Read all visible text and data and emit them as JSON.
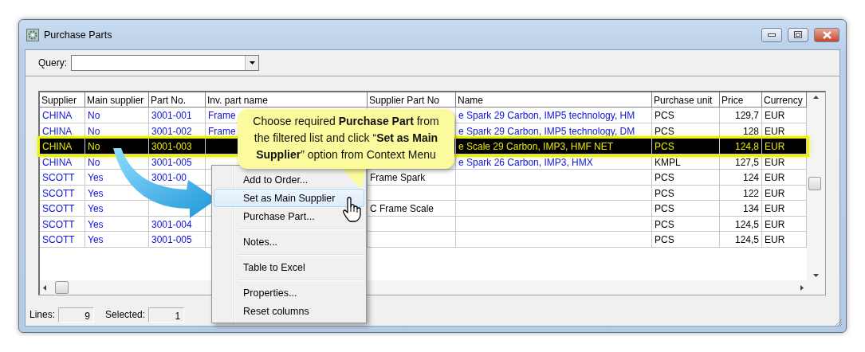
{
  "window": {
    "title": "Purchase Parts"
  },
  "query": {
    "label": "Query:"
  },
  "table": {
    "columns": [
      {
        "label": "Supplier",
        "kind": "link"
      },
      {
        "label": "Main supplier",
        "kind": "link"
      },
      {
        "label": "Part No.",
        "kind": "link"
      },
      {
        "label": "Inv. part name",
        "kind": "link"
      },
      {
        "label": "Supplier Part No",
        "kind": "text"
      },
      {
        "label": "Name",
        "kind": "link"
      },
      {
        "label": "Purchase unit",
        "kind": "text"
      },
      {
        "label": "Price",
        "kind": "number"
      },
      {
        "label": "Currency",
        "kind": "text"
      }
    ],
    "rows": [
      {
        "selected": false,
        "cells": [
          "CHINA",
          "No",
          "3001-001",
          "Frame",
          null,
          "e Spark 29 Carbon, IMP5 technology, HM",
          "PCS",
          "129,7",
          "EUR"
        ]
      },
      {
        "selected": false,
        "cells": [
          "CHINA",
          "No",
          "3001-002",
          "Frame",
          null,
          "e Spark 29 Carbon, IMP5 technology, DM",
          "PCS",
          "128",
          "EUR"
        ]
      },
      {
        "selected": true,
        "cells": [
          "CHINA",
          "No",
          "3001-003",
          null,
          null,
          "e Scale 29 Carbon, IMP3, HMF NET",
          "PCS",
          "124,8",
          "EUR"
        ]
      },
      {
        "selected": false,
        "cells": [
          "CHINA",
          "No",
          "3001-005",
          null,
          null,
          "e Spark 26 Carbon, IMP3, HMX",
          "KMPL",
          "127,5",
          "EUR"
        ]
      },
      {
        "selected": false,
        "cells": [
          "SCOTT",
          "Yes",
          "3001-00",
          null,
          "Frame Spark",
          null,
          "PCS",
          "124",
          "EUR"
        ]
      },
      {
        "selected": false,
        "cells": [
          "SCOTT",
          "Yes",
          null,
          null,
          null,
          null,
          "PCS",
          "122",
          "EUR"
        ]
      },
      {
        "selected": false,
        "cells": [
          "SCOTT",
          "Yes",
          null,
          null,
          "C Frame Scale",
          null,
          "PCS",
          "134",
          "EUR"
        ]
      },
      {
        "selected": false,
        "cells": [
          "SCOTT",
          "Yes",
          "3001-004",
          null,
          null,
          null,
          "PCS",
          "124,5",
          "EUR"
        ]
      },
      {
        "selected": false,
        "cells": [
          "SCOTT",
          "Yes",
          "3001-005",
          null,
          null,
          null,
          "PCS",
          "124,5",
          "EUR"
        ]
      }
    ]
  },
  "context_menu": {
    "items": [
      {
        "kind": "item",
        "label": "Add to Order...",
        "highlighted": false
      },
      {
        "kind": "item",
        "label": "Set as Main Supplier",
        "highlighted": true
      },
      {
        "kind": "item",
        "label": "Purchase Part...",
        "highlighted": false
      },
      {
        "kind": "separator"
      },
      {
        "kind": "item",
        "label": "Notes...",
        "highlighted": false
      },
      {
        "kind": "separator"
      },
      {
        "kind": "item",
        "label": "Table to Excel",
        "highlighted": false
      },
      {
        "kind": "separator"
      },
      {
        "kind": "item",
        "label": "Properties...",
        "highlighted": false
      },
      {
        "kind": "item",
        "label": "Reset columns",
        "highlighted": false
      }
    ]
  },
  "callout": {
    "text": "Choose required **Purchase Part** from the filtered list and click “**Set as Main Supplier**” option from Context Menu"
  },
  "status_bar": {
    "lines_label": "Lines:",
    "lines": "9",
    "selected_label": "Selected:",
    "selected": "1"
  }
}
